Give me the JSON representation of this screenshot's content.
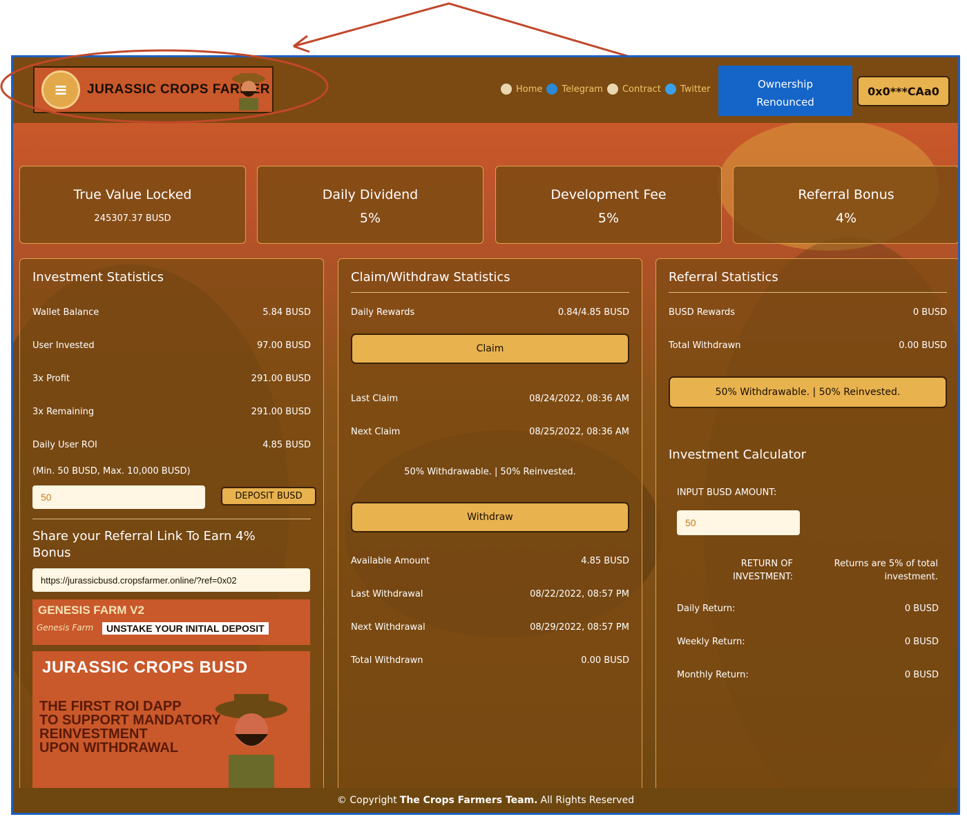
{
  "header": {
    "logo_text": "JURASSIC CROPS FARMER",
    "nav": [
      {
        "label": "Home",
        "icon": "home-icon"
      },
      {
        "label": "Telegram",
        "icon": "telegram-icon"
      },
      {
        "label": "Contract",
        "icon": "contract-icon"
      },
      {
        "label": "Twitter",
        "icon": "twitter-icon"
      }
    ],
    "ownership_line1": "Ownership",
    "ownership_line2": "Renounced",
    "wallet": "0x0***CAa0"
  },
  "stats": [
    {
      "title": "True Value Locked",
      "value": "245307.37 BUSD"
    },
    {
      "title": "Daily Dividend",
      "value": "5%"
    },
    {
      "title": "Development Fee",
      "value": "5%"
    },
    {
      "title": "Referral Bonus",
      "value": "4%"
    }
  ],
  "investment": {
    "title": "Investment Statistics",
    "rows": [
      {
        "label": "Wallet Balance",
        "value": "5.84 BUSD"
      },
      {
        "label": "User Invested",
        "value": "97.00 BUSD"
      },
      {
        "label": "3x Profit",
        "value": "291.00 BUSD"
      },
      {
        "label": "3x Remaining",
        "value": "291.00 BUSD"
      },
      {
        "label": "Daily User ROI",
        "value": "4.85 BUSD"
      }
    ],
    "limits": "(Min. 50 BUSD, Max. 10,000 BUSD)",
    "deposit_value": "50",
    "deposit_label": "DEPOSIT BUSD",
    "referral_title": "Share your Referral Link To Earn 4% Bonus",
    "referral_link": "https://jurassicbusd.cropsfarmer.online/?ref=0x02"
  },
  "banners": {
    "genesis_title": "GENESIS FARM V2",
    "genesis_logo": "Genesis Farm",
    "genesis_sub": "UNSTAKE YOUR INITIAL DEPOSIT",
    "jurassic_title": "JURASSIC CROPS BUSD",
    "jurassic_text": "THE FIRST ROI DAPP\nTO SUPPORT MANDATORY\nREINVESTMENT\nUPON WITHDRAWAL"
  },
  "claim": {
    "title": "Claim/Withdraw Statistics",
    "daily_rewards_label": "Daily Rewards",
    "daily_rewards_value": "0.84/4.85 BUSD",
    "claim_label": "Claim",
    "last_claim_label": "Last Claim",
    "last_claim_value": "08/24/2022, 08:36 AM",
    "next_claim_label": "Next Claim",
    "next_claim_value": "08/25/2022, 08:36 AM",
    "split_text": "50% Withdrawable. | 50% Reinvested.",
    "withdraw_label": "Withdraw",
    "rows": [
      {
        "label": "Available Amount",
        "value": "4.85 BUSD"
      },
      {
        "label": "Last Withdrawal",
        "value": "08/22/2022, 08:57 PM"
      },
      {
        "label": "Next Withdrawal",
        "value": "08/29/2022, 08:57 PM"
      },
      {
        "label": "Total Withdrawn",
        "value": "0.00 BUSD"
      }
    ]
  },
  "referral": {
    "title": "Referral Statistics",
    "rows": [
      {
        "label": "BUSD Rewards",
        "value": "0 BUSD"
      },
      {
        "label": "Total Withdrawn",
        "value": "0.00 BUSD"
      }
    ],
    "split_text": "50% Withdrawable. | 50% Reinvested."
  },
  "calculator": {
    "title": "Investment Calculator",
    "input_label": "INPUT BUSD AMOUNT:",
    "input_value": "50",
    "roi_label": "RETURN OF INVESTMENT:",
    "roi_note": "Returns are 5% of total investment.",
    "rows": [
      {
        "label": "Daily Return:",
        "value": "0 BUSD"
      },
      {
        "label": "Weekly Return:",
        "value": "0 BUSD"
      },
      {
        "label": "Monthly Return:",
        "value": "0 BUSD"
      }
    ]
  },
  "footer": {
    "prefix": "© Copyright ",
    "team": "The Crops Farmers Team.",
    "suffix": " All Rights Reserved"
  },
  "colors": {
    "accent": "#e8b24f",
    "panel_border": "#e0a24a",
    "ownership_blue": "#1565c8",
    "annotation_red": "#c0472a"
  }
}
